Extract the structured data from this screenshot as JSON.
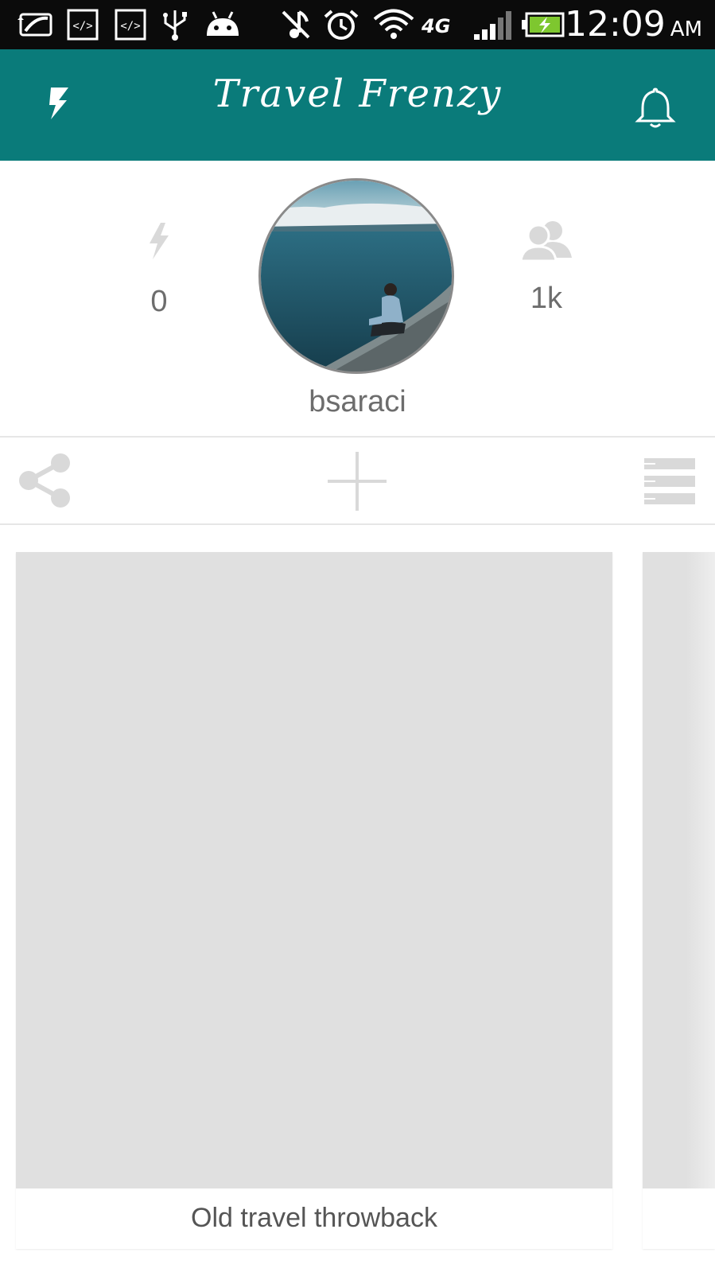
{
  "status_bar": {
    "time": "12:09",
    "ampm": "AM",
    "network": "4G",
    "icons": [
      "sync-icon",
      "code-icon",
      "code-icon",
      "usb-icon",
      "android-debug-icon",
      "music-muted-icon",
      "alarm-icon",
      "wifi-icon",
      "network-4g-icon",
      "signal-icon",
      "battery-charging-icon"
    ]
  },
  "app_bar": {
    "title": "Travel Frenzy",
    "left_icon": "flash-logo-icon",
    "right_icon": "bell-icon"
  },
  "profile": {
    "username": "bsaraci",
    "left_stat": {
      "icon": "lightning-icon",
      "value": "0"
    },
    "right_stat": {
      "icon": "people-icon",
      "value": "1k"
    }
  },
  "toolbar": {
    "icons": [
      "share-icon",
      "add-icon",
      "list-view-icon"
    ]
  },
  "cards": [
    {
      "caption": "Old travel throwback"
    },
    {
      "caption": ""
    }
  ],
  "colors": {
    "primary": "#0a7b7a",
    "placeholder": "#e0e0e0",
    "icon_gray": "#d9d9d9",
    "text_gray": "#6d6d6d"
  }
}
